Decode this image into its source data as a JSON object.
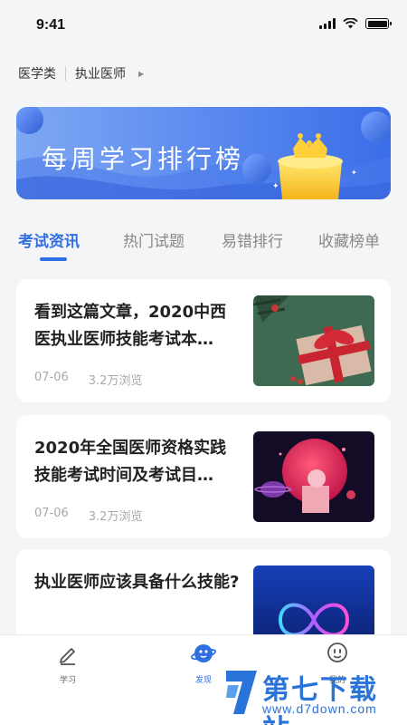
{
  "status_bar": {
    "time": "9:41"
  },
  "category": {
    "level1": "医学类",
    "level2": "执业医师"
  },
  "banner": {
    "title": "每周学习排行榜"
  },
  "tabs": [
    {
      "label": "考试资讯",
      "active": true
    },
    {
      "label": "热门试题",
      "active": false
    },
    {
      "label": "易错排行",
      "active": false
    },
    {
      "label": "收藏榜单",
      "active": false
    }
  ],
  "articles": [
    {
      "title": "看到这篇文章，2020中西医执业医师技能考试本…",
      "date": "07-06",
      "views": "3.2万浏览",
      "thumb": "gift"
    },
    {
      "title": "2020年全国医师资格实践技能考试时间及考试目…",
      "date": "07-06",
      "views": "3.2万浏览",
      "thumb": "planet"
    },
    {
      "title": "执业医师应该具备什么技能?",
      "thumb": "neon"
    }
  ],
  "bottom_nav": [
    {
      "label": "学习",
      "icon": "pencil-icon",
      "active": false
    },
    {
      "label": "发现",
      "icon": "planet-icon",
      "active": true
    },
    {
      "label": "我的",
      "icon": "smiley-icon",
      "active": false
    }
  ],
  "watermark": {
    "text": "第七下载站",
    "url": "www.d7down.com"
  },
  "colors": {
    "accent": "#2f6fe4",
    "background": "#f4f5f7"
  }
}
